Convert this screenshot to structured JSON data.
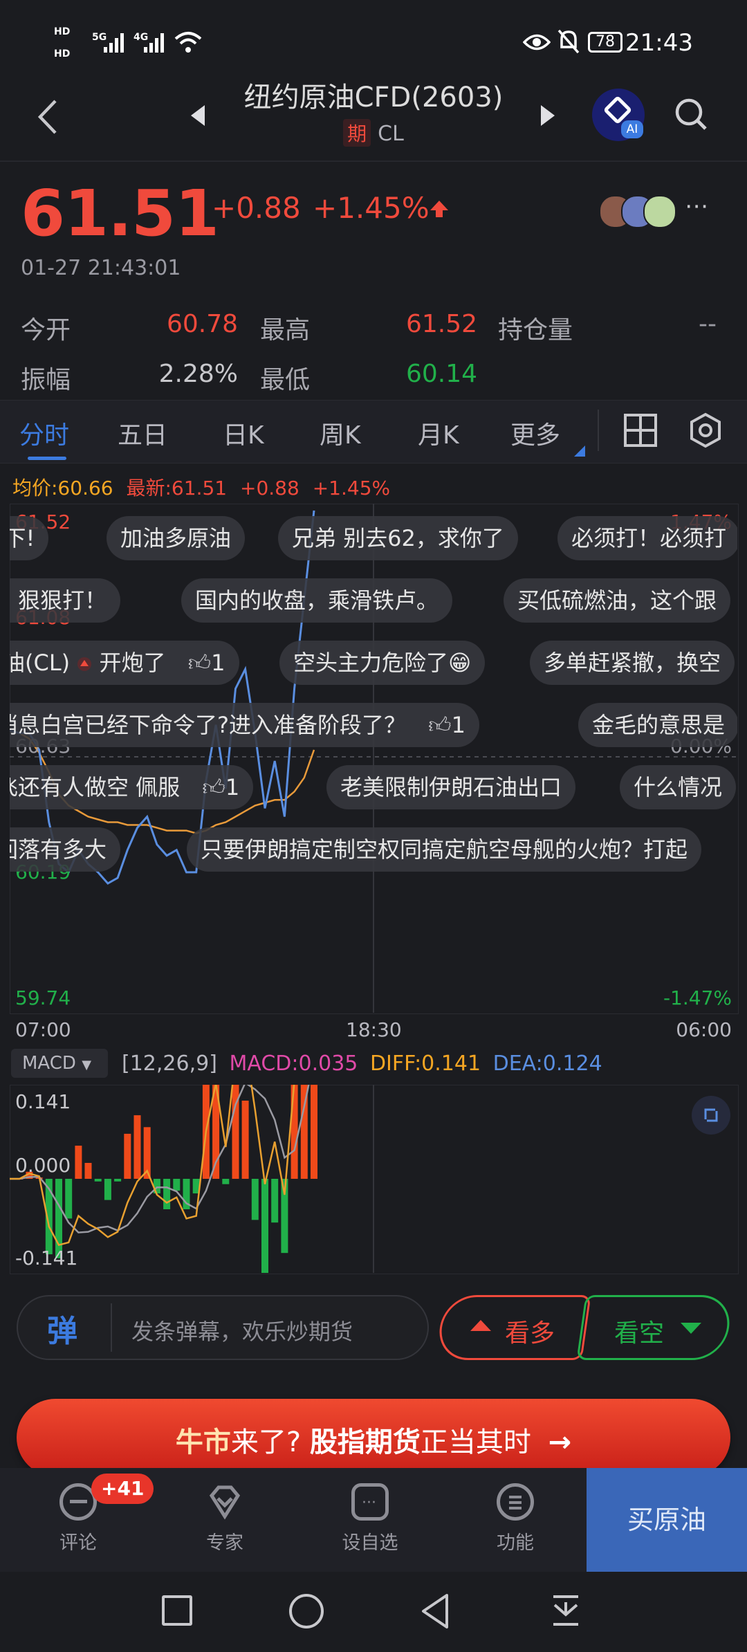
{
  "status_bar": {
    "time": "21:43",
    "battery": "78",
    "sim1": "HD",
    "sim2": "HD",
    "net1": "5G",
    "net2": "4G"
  },
  "header": {
    "title": "纽约原油CFD(2603)",
    "badge": "期",
    "code": "CL"
  },
  "quote": {
    "price": "61.51",
    "change": "+0.88",
    "change_pct": "+1.45%",
    "timestamp": "01-27 21:43:01",
    "stats": [
      {
        "label": "今开",
        "value": "60.78"
      },
      {
        "label": "最高",
        "value": "61.52"
      },
      {
        "label": "持仓量",
        "value": "--"
      },
      {
        "label": "振幅",
        "value": "2.28%"
      },
      {
        "label": "最低",
        "value": "60.14"
      }
    ]
  },
  "tabs": [
    "分时",
    "五日",
    "日K",
    "周K",
    "月K",
    "更多"
  ],
  "chart_info": {
    "avg": "均价:60.66",
    "latest": "最新:61.51",
    "chg": "+0.88",
    "chg_pct": "+1.45%"
  },
  "chart_labels": {
    "y_top": "61.52",
    "y_q1": "61.08",
    "y_mid": "60.63",
    "y_q3": "60.19",
    "y_bot": "59.74",
    "pct_top": "1.47%",
    "pct_mid": "0.00%",
    "pct_bot": "-1.47%",
    "x": [
      "07:00",
      "18:30",
      "06:00"
    ]
  },
  "macd": {
    "selector": "MACD",
    "params": "[12,26,9]",
    "macd": "MACD:0.035",
    "diff": "DIFF:0.141",
    "dea": "DEA:0.124",
    "y_top": "0.141",
    "y_mid": "0.000",
    "y_bot": "-0.141"
  },
  "danmaku": [
    [
      "-下!",
      "加油多原油",
      "兄弟 别去62，求你了",
      "必须打！必须打"
    ],
    [
      "， 狠狠打！",
      "国内的收盘，乘滑铁卢。",
      "买低硫燃油，这个跟"
    ],
    [
      "油(CL)",
      "开炮了",
      "1",
      "空头主力危险了😁",
      "多单赶紧撤，换空"
    ],
    [
      "消息白宫已经下命令了?进入准备阶段了？",
      "1",
      "金毛的意思是"
    ],
    [
      "飞还有人做空 佩服",
      "1",
      "老美限制伊朗石油出口",
      "什么情况"
    ],
    [
      "回落有多大",
      "只要伊朗搞定制空权同搞定航空母舰的火炮？打起"
    ]
  ],
  "comment_bar": {
    "icon": "弹",
    "placeholder": "发条弹幕，欢乐炒期货",
    "bull": "看多",
    "bear": "看空"
  },
  "banner": {
    "part1": "牛市",
    "part2": "来了?",
    "part3": "股指期货",
    "part4": "正当其时",
    "arrow": "→"
  },
  "bottom_nav": [
    {
      "label": "评论",
      "badge": "+41"
    },
    {
      "label": "专家"
    },
    {
      "label": "设自选"
    },
    {
      "label": "功能"
    }
  ],
  "buy_button": "买原油",
  "chart_data": {
    "type": "line",
    "title": "",
    "x_ticks": [
      "07:00",
      "18:30",
      "06:00"
    ],
    "ylim": [
      59.74,
      61.52
    ],
    "ref_price": 60.63,
    "series": [
      {
        "name": "最新",
        "values": [
          60.73,
          60.72,
          60.72,
          60.66,
          60.4,
          60.25,
          60.22,
          60.3,
          60.25,
          60.22,
          60.18,
          60.2,
          60.3,
          60.38,
          60.42,
          60.32,
          60.28,
          60.3,
          60.22,
          60.22,
          60.55,
          60.75,
          60.52,
          60.88,
          60.95,
          60.72,
          60.45,
          60.62,
          60.42,
          60.88,
          61.2,
          61.52
        ]
      },
      {
        "name": "均价",
        "values": [
          60.73,
          60.72,
          60.7,
          60.65,
          60.58,
          60.5,
          60.46,
          60.44,
          60.42,
          60.41,
          60.4,
          60.4,
          60.39,
          60.39,
          60.39,
          60.38,
          60.37,
          60.37,
          60.37,
          60.36,
          60.37,
          60.39,
          60.4,
          60.42,
          60.44,
          60.46,
          60.47,
          60.48,
          60.48,
          60.51,
          60.56,
          60.66
        ]
      }
    ]
  }
}
